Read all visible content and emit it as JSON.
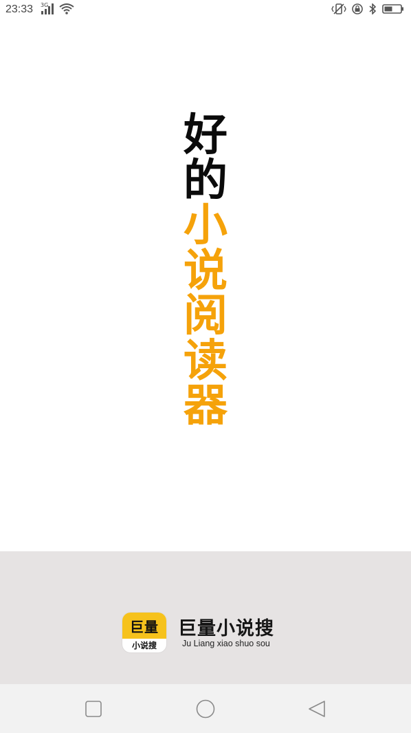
{
  "status_bar": {
    "time": "23:33",
    "network_type": "3G",
    "icons": [
      "signal-icon",
      "wifi-icon",
      "vibrate-icon",
      "rotation-lock-icon",
      "bluetooth-icon",
      "battery-icon"
    ]
  },
  "slogan": {
    "chars": [
      "好",
      "的",
      "小",
      "说",
      "阅",
      "读",
      "器"
    ],
    "colors": {
      "black": "#0b0b0b",
      "orange": "#f5a20a"
    }
  },
  "brand": {
    "logo_top": "巨量",
    "logo_bottom": "小说搜",
    "name": "巨量小说搜",
    "pinyin": "Ju Liang xiao shuo sou",
    "logo_color": "#f6c21c",
    "background": "#e6e3e3"
  },
  "nav_bar": {
    "buttons": [
      "recent-apps",
      "home",
      "back"
    ]
  }
}
